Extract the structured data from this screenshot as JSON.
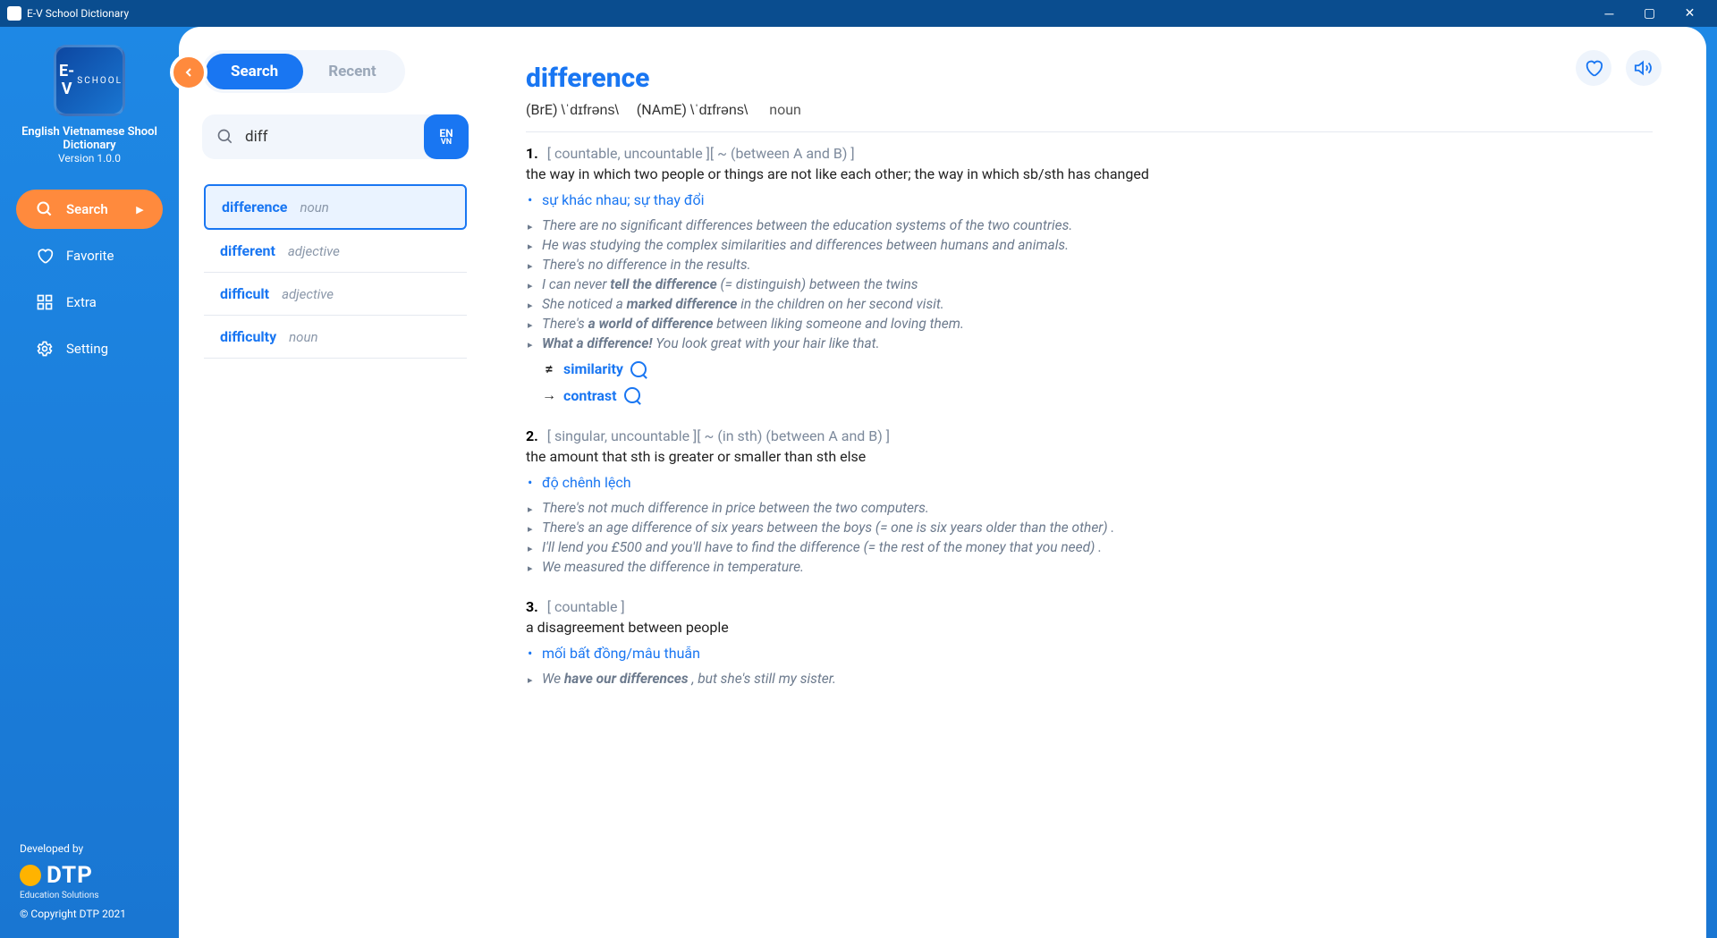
{
  "window": {
    "title": "E-V School Dictionary"
  },
  "sidebar": {
    "app_title": "English Vietnamese Shool Dictionary",
    "version": "Version 1.0.0",
    "items": [
      {
        "label": "Search"
      },
      {
        "label": "Favorite"
      },
      {
        "label": "Extra"
      },
      {
        "label": "Setting"
      }
    ],
    "developed_by": "Developed by",
    "brand": "DTP",
    "brand_sub": "Education Solutions",
    "copyright": "© Copyright DTP 2021"
  },
  "tabs": {
    "search": "Search",
    "recent": "Recent"
  },
  "search": {
    "value": "diff",
    "lang_top": "EN",
    "lang_bot": "VN"
  },
  "results": [
    {
      "word": "difference",
      "pos": "noun",
      "selected": true
    },
    {
      "word": "different",
      "pos": "adjective",
      "selected": false
    },
    {
      "word": "difficult",
      "pos": "adjective",
      "selected": false
    },
    {
      "word": "difficulty",
      "pos": "noun",
      "selected": false
    }
  ],
  "entry": {
    "headword": "difference",
    "bre_label": "(BrE)",
    "bre_ipa": "\\ˈdɪfrəns\\",
    "name_label": "(NAmE)",
    "name_ipa": "\\ˈdɪfrəns\\",
    "pos": "noun",
    "senses": [
      {
        "num": "1.",
        "gram": "[ countable, uncountable ][ ~ (between A and B) ]",
        "def": "the way in which two people or things are not like each other; the way in which sb/sth has changed",
        "trans": "sự khác nhau; sự thay đổi",
        "examples": [
          "There are no significant differences between the education systems of the two countries.",
          "He was studying the complex similarities and differences between humans and animals.",
          "There's no difference in the results.",
          "I can never <b>tell the difference</b> (= distinguish) between the twins",
          "She noticed a <b>marked difference</b> in the children on her second visit.",
          "There's <b>a world of difference</b> between liking someone and loving them.",
          "<b>What a difference!</b> You look great with your hair like that."
        ],
        "xrefs": [
          {
            "sym": "≠",
            "word": "similarity"
          },
          {
            "sym": "→",
            "word": "contrast"
          }
        ]
      },
      {
        "num": "2.",
        "gram": "[ singular, uncountable ][ ~ (in sth) (between A and B) ]",
        "def": "the amount that sth is greater or smaller than sth else",
        "trans": "độ chênh lệch",
        "examples": [
          "There's not much difference in price between the two computers.",
          "There's an age difference of six years between the boys (= one is six years older than the other) .",
          "I'll lend you £500 and you'll have to find the difference (= the rest of the money that you need) .",
          "We measured the difference in temperature."
        ],
        "xrefs": []
      },
      {
        "num": "3.",
        "gram": "[ countable ]",
        "def": "a disagreement between people",
        "trans": "mối bất đồng/mâu thuẫn",
        "examples": [
          "We <b>have our differences</b> , but she's still my sister."
        ],
        "xrefs": []
      }
    ]
  }
}
